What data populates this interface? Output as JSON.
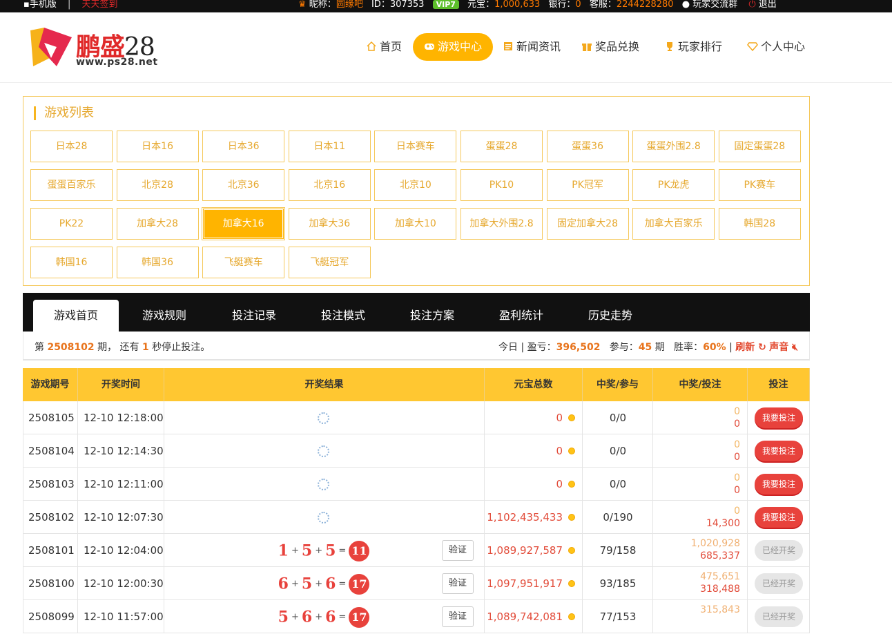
{
  "topbar": {
    "mobile": "手机版",
    "sep": "|",
    "signin": "天天签到",
    "nickname_label": "昵称：",
    "nickname": "圆缘吧",
    "id_label": "ID：",
    "id": "307353",
    "vip": "VIP7",
    "yuanbao_label": "元宝：",
    "yuanbao": "1,000,633",
    "bank_label": "银行：",
    "bank": "0",
    "service_label": "客服：",
    "service": "2244228280",
    "group": "玩家交流群",
    "logout": "退出"
  },
  "logo": {
    "brand_cn": "鹏盛",
    "brand_num": "28",
    "url": "www.ps28.net"
  },
  "nav": [
    {
      "label": "首页",
      "icon": "home-icon"
    },
    {
      "label": "游戏中心",
      "icon": "gamepad-icon",
      "active": true
    },
    {
      "label": "新闻资讯",
      "icon": "news-icon"
    },
    {
      "label": "奖品兑换",
      "icon": "gift-icon"
    },
    {
      "label": "玩家排行",
      "icon": "trophy-icon"
    },
    {
      "label": "个人中心",
      "icon": "diamond-icon"
    }
  ],
  "gamelist": {
    "title": "游戏列表",
    "games": [
      "日本28",
      "日本16",
      "日本36",
      "日本11",
      "日本赛车",
      "蛋蛋28",
      "蛋蛋36",
      "蛋蛋外围2.8",
      "固定蛋蛋28",
      "蛋蛋百家乐",
      "北京28",
      "北京36",
      "北京16",
      "北京10",
      "PK10",
      "PK冠军",
      "PK龙虎",
      "PK赛车",
      "PK22",
      "加拿大28",
      "加拿大16",
      "加拿大36",
      "加拿大10",
      "加拿大外围2.8",
      "固定加拿大28",
      "加拿大百家乐",
      "韩国28",
      "韩国16",
      "韩国36",
      "飞艇赛车",
      "飞艇冠军"
    ],
    "active": "加拿大16"
  },
  "tabs": [
    "游戏首页",
    "游戏规则",
    "投注记录",
    "投注模式",
    "投注方案",
    "盈利统计",
    "历史走势"
  ],
  "info": {
    "p1": "第",
    "period": "2508102",
    "p2": "期，  还有",
    "secs": "1",
    "p3": "秒停止投注。",
    "today": "今日 | 盈亏：",
    "profit": "396,502",
    "join_label": "参与：",
    "join": "45",
    "join_unit": "期",
    "win_label": "胜率：",
    "win": "60%",
    "bar": "|",
    "refresh": "刷新",
    "sound": "声音"
  },
  "table": {
    "headers": [
      "游戏期号",
      "开奖时间",
      "开奖结果",
      "元宝总数",
      "中奖/参与",
      "中奖/投注",
      "投注"
    ],
    "verify_label": "验证",
    "bet_label": "我要投注",
    "done_label": "已经开奖",
    "rows": [
      {
        "period": "2508105",
        "time": "12-10 12:18:00",
        "pending": true,
        "total": "0",
        "win_join": "0/0",
        "win": "0",
        "bet": "0",
        "open": false
      },
      {
        "period": "2508104",
        "time": "12-10 12:14:30",
        "pending": true,
        "total": "0",
        "win_join": "0/0",
        "win": "0",
        "bet": "0",
        "open": false
      },
      {
        "period": "2508103",
        "time": "12-10 12:11:00",
        "pending": true,
        "total": "0",
        "win_join": "0/0",
        "win": "0",
        "bet": "0",
        "open": false
      },
      {
        "period": "2508102",
        "time": "12-10 12:07:30",
        "pending": true,
        "total": "1,102,435,433",
        "win_join": "0/190",
        "win": "0",
        "bet": "14,300",
        "open": false
      },
      {
        "period": "2508101",
        "time": "12-10 12:04:00",
        "pending": false,
        "a": "1",
        "b": "5",
        "c": "5",
        "sum": "11",
        "total": "1,089,927,587",
        "win_join": "79/158",
        "win": "1,020,928",
        "bet": "685,337",
        "open": true
      },
      {
        "period": "2508100",
        "time": "12-10 12:00:30",
        "pending": false,
        "a": "6",
        "b": "5",
        "c": "6",
        "sum": "17",
        "total": "1,097,951,917",
        "win_join": "93/185",
        "win": "475,651",
        "bet": "318,488",
        "open": true
      },
      {
        "period": "2508099",
        "time": "12-10 11:57:00",
        "pending": false,
        "a": "5",
        "b": "6",
        "c": "6",
        "sum": "17",
        "total": "1,089,742,081",
        "win_join": "77/153",
        "win": "315,843",
        "bet": "",
        "open": true
      }
    ]
  }
}
